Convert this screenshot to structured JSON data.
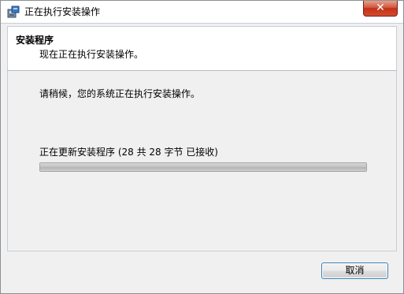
{
  "window": {
    "title": "正在执行安装操作",
    "close_label": "✕"
  },
  "header": {
    "title": "安装程序",
    "subtitle": "现在正在执行安装操作。"
  },
  "main": {
    "message": "请稍候，您的系统正在执行安装操作。",
    "progress_label": "正在更新安装程序 (28 共 28 字节 已接收)",
    "progress_fraction": 1.0
  },
  "footer": {
    "cancel_label": "取消"
  },
  "colors": {
    "close_button": "#c43216",
    "button_border": "#3c7fb1",
    "panel_background": "#ffffff",
    "window_background": "#f0f0f0"
  },
  "icons": {
    "app_icon": "installer-icon",
    "close_icon": "close-icon"
  }
}
